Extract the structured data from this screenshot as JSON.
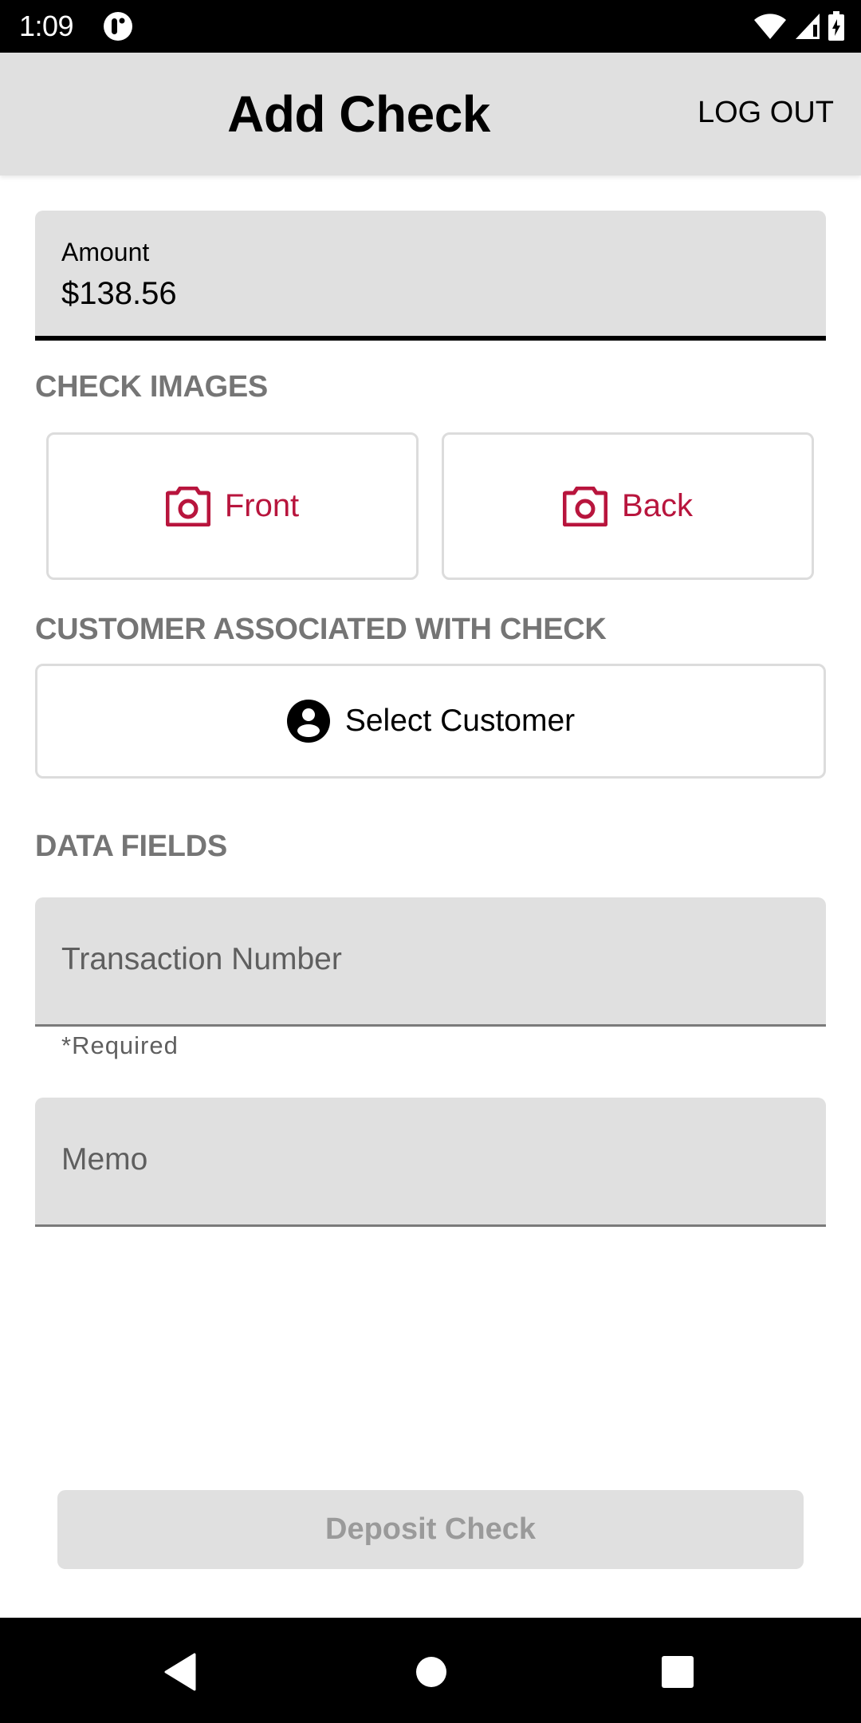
{
  "status_bar": {
    "time": "1:09",
    "icons": [
      "app-notification-icon",
      "wifi-icon",
      "cellular-signal-icon",
      "battery-charging-icon"
    ]
  },
  "app_bar": {
    "title": "Add Check",
    "logout_label": "LOG OUT"
  },
  "amount": {
    "label": "Amount",
    "value": "$138.56"
  },
  "check_images": {
    "heading": "CHECK IMAGES",
    "front_label": "Front",
    "back_label": "Back",
    "icon": "camera-icon"
  },
  "customer": {
    "heading": "CUSTOMER ASSOCIATED WITH CHECK",
    "button_label": "Select Customer",
    "icon": "account-circle-icon"
  },
  "data_fields": {
    "heading": "DATA FIELDS",
    "transaction_placeholder": "Transaction Number",
    "transaction_value": "",
    "transaction_helper": "*Required",
    "memo_placeholder": "Memo",
    "memo_value": ""
  },
  "actions": {
    "deposit_label": "Deposit Check",
    "deposit_enabled": false
  },
  "nav_bar": {
    "icons": [
      "back-icon",
      "home-icon",
      "recents-icon"
    ]
  },
  "colors": {
    "accent": "#b8153d",
    "app_bar_bg": "#e0e0e0",
    "section_heading": "#757575",
    "disabled_text": "#9a9a9a"
  }
}
